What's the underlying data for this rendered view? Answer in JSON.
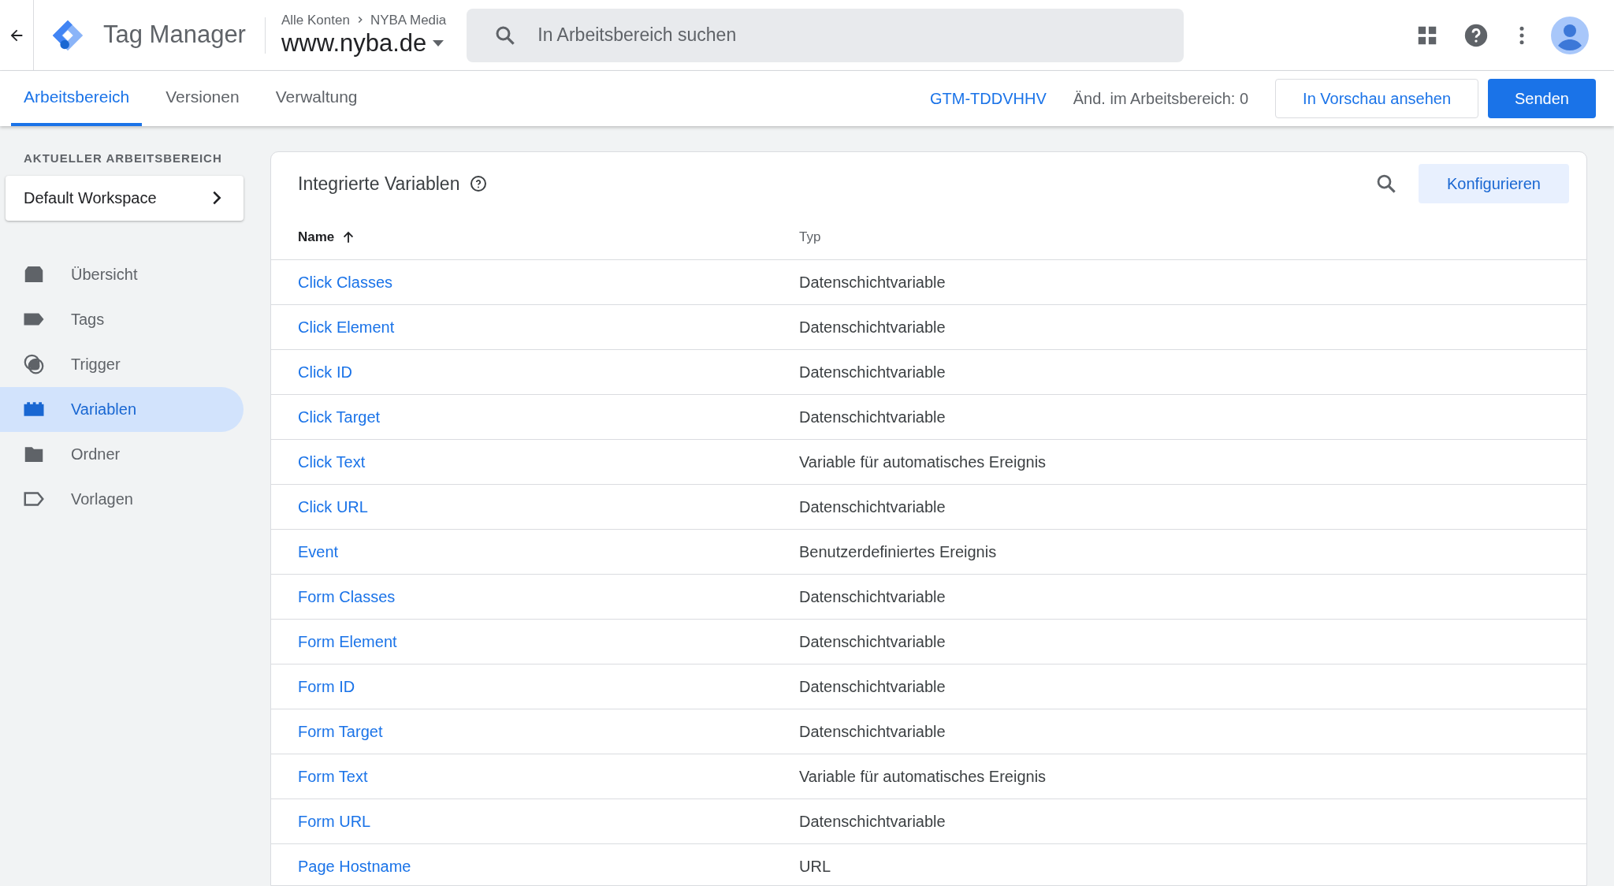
{
  "header": {
    "product": "Tag Manager",
    "breadcrumb": [
      "Alle Konten",
      "NYBA Media"
    ],
    "container": "www.nyba.de",
    "search": {
      "placeholder": "In Arbeitsbereich suchen"
    }
  },
  "tabs": [
    {
      "label": "Arbeitsbereich",
      "selected": true
    },
    {
      "label": "Versionen",
      "selected": false
    },
    {
      "label": "Verwaltung",
      "selected": false
    }
  ],
  "toolbar": {
    "container_id": "GTM-TDDVHHV",
    "changes": "Änd. im Arbeitsbereich: 0",
    "preview_button": "In Vorschau ansehen",
    "submit_button": "Senden"
  },
  "sidebar": {
    "section_label": "AKTUELLER ARBEITSBEREICH",
    "workspace": "Default Workspace",
    "items": [
      {
        "kind": "overview",
        "label": "Übersicht",
        "selected": false
      },
      {
        "kind": "tags",
        "label": "Tags",
        "selected": false
      },
      {
        "kind": "trigger",
        "label": "Trigger",
        "selected": false
      },
      {
        "kind": "variables",
        "label": "Variablen",
        "selected": true
      },
      {
        "kind": "folder",
        "label": "Ordner",
        "selected": false
      },
      {
        "kind": "templates",
        "label": "Vorlagen",
        "selected": false
      }
    ]
  },
  "panel": {
    "title": "Integrierte Variablen",
    "configure_button": "Konfigurieren",
    "table": {
      "columns": [
        "Name",
        "Typ"
      ],
      "rows": [
        [
          "Click Classes",
          "Datenschichtvariable"
        ],
        [
          "Click Element",
          "Datenschichtvariable"
        ],
        [
          "Click ID",
          "Datenschichtvariable"
        ],
        [
          "Click Target",
          "Datenschichtvariable"
        ],
        [
          "Click Text",
          "Variable für automatisches Ereignis"
        ],
        [
          "Click URL",
          "Datenschichtvariable"
        ],
        [
          "Event",
          "Benutzerdefiniertes Ereignis"
        ],
        [
          "Form Classes",
          "Datenschichtvariable"
        ],
        [
          "Form Element",
          "Datenschichtvariable"
        ],
        [
          "Form ID",
          "Datenschichtvariable"
        ],
        [
          "Form Target",
          "Datenschichtvariable"
        ],
        [
          "Form Text",
          "Variable für automatisches Ereignis"
        ],
        [
          "Form URL",
          "Datenschichtvariable"
        ],
        [
          "Page Hostname",
          "URL"
        ]
      ]
    }
  }
}
